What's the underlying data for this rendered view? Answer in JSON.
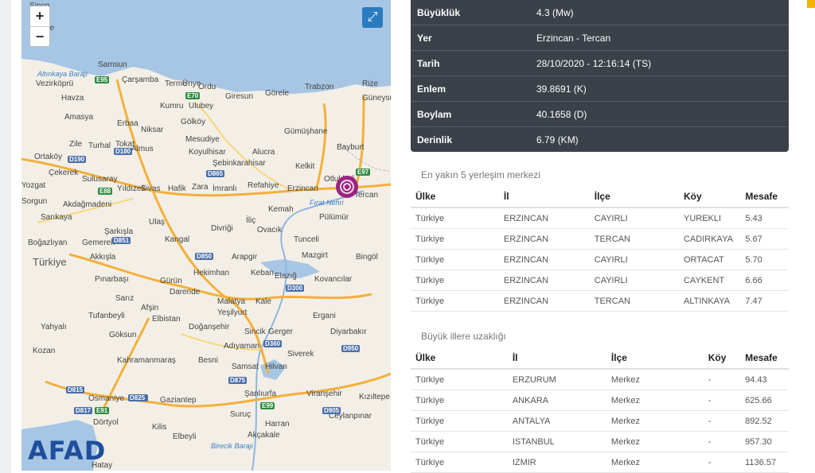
{
  "map": {
    "zoom_in": "+",
    "zoom_out": "−",
    "fullscreen": "⤢",
    "logo": "AFAD",
    "labels": [
      {
        "t": "Sinop"
      },
      {
        "t": "Gerze"
      },
      {
        "t": "Samsun"
      },
      {
        "t": "Altınkaya Barajı"
      },
      {
        "t": "Vezirköprü"
      },
      {
        "t": "Havza"
      },
      {
        "t": "Çarşamba"
      },
      {
        "t": "Terme"
      },
      {
        "t": "Ünye"
      },
      {
        "t": "Ordu"
      },
      {
        "t": "Giresun"
      },
      {
        "t": "Görele"
      },
      {
        "t": "Trabzon"
      },
      {
        "t": "Rize"
      },
      {
        "t": "Güneysu"
      },
      {
        "t": "Amasya"
      },
      {
        "t": "Tokat"
      },
      {
        "t": "Kumru"
      },
      {
        "t": "Ulubey"
      },
      {
        "t": "Gölköy"
      },
      {
        "t": "Mesudiye"
      },
      {
        "t": "Koyulhisar"
      },
      {
        "t": "Şebinkarahisar"
      },
      {
        "t": "Gümüşhane"
      },
      {
        "t": "Bayburt"
      },
      {
        "t": "Alucra"
      },
      {
        "t": "Kelkit"
      },
      {
        "t": "Erzincan"
      },
      {
        "t": "Tercan"
      },
      {
        "t": "Otlukbeli"
      },
      {
        "t": "Sivas"
      },
      {
        "t": "Hafik"
      },
      {
        "t": "Zara"
      },
      {
        "t": "İmranlı"
      },
      {
        "t": "Refahiye"
      },
      {
        "t": "Kemah"
      },
      {
        "t": "Pülümür"
      },
      {
        "t": "Tunceli"
      },
      {
        "t": "Mazgirt"
      },
      {
        "t": "Bingöl"
      },
      {
        "t": "Ovacık"
      },
      {
        "t": "İliç"
      },
      {
        "t": "Divriği"
      },
      {
        "t": "Arapgir"
      },
      {
        "t": "Kangal"
      },
      {
        "t": "Ulaş"
      },
      {
        "t": "Gürün"
      },
      {
        "t": "Hekimhan"
      },
      {
        "t": "Keban"
      },
      {
        "t": "Elazığ"
      },
      {
        "t": "Kovancılar"
      },
      {
        "t": "Malatya"
      },
      {
        "t": "Darende"
      },
      {
        "t": "Yeşilyurt"
      },
      {
        "t": "Kale"
      },
      {
        "t": "Doğanşehir"
      },
      {
        "t": "Sincik"
      },
      {
        "t": "Gerger"
      },
      {
        "t": "Ergani"
      },
      {
        "t": "Diyarbakır"
      },
      {
        "t": "Adıyaman"
      },
      {
        "t": "Kahramanmaraş"
      },
      {
        "t": "Besni"
      },
      {
        "t": "Samsat"
      },
      {
        "t": "Hilvan"
      },
      {
        "t": "Siverek"
      },
      {
        "t": "Gaziantep"
      },
      {
        "t": "Şanlıurfa"
      },
      {
        "t": "Viranşehir"
      },
      {
        "t": "Osmaniye"
      },
      {
        "t": "Kilis"
      },
      {
        "t": "Elbeyli"
      },
      {
        "t": "Suruç"
      },
      {
        "t": "Harran"
      },
      {
        "t": "Akçakale"
      },
      {
        "t": "Ceylanpınar"
      },
      {
        "t": "Kızıltepe"
      },
      {
        "t": "Dörtyol"
      },
      {
        "t": "Hatay"
      },
      {
        "t": "Türkiye"
      },
      {
        "t": "Elbistan"
      },
      {
        "t": "Göksun"
      },
      {
        "t": "Afşin"
      },
      {
        "t": "Pınarbaşı"
      },
      {
        "t": "Sarız"
      },
      {
        "t": "Tufanbeyli"
      },
      {
        "t": "Kozan"
      },
      {
        "t": "Yahyalı"
      },
      {
        "t": "Akkışla"
      },
      {
        "t": "Gemerek"
      },
      {
        "t": "Şarkışla"
      },
      {
        "t": "Yozgat"
      },
      {
        "t": "Sorgun"
      },
      {
        "t": "Çekerek"
      },
      {
        "t": "Turhal"
      },
      {
        "t": "Zile"
      },
      {
        "t": "Erbaa"
      },
      {
        "t": "Niksar"
      },
      {
        "t": "Almus"
      },
      {
        "t": "Ortaköy"
      },
      {
        "t": "Sulusaray"
      },
      {
        "t": "Yıldızeli"
      },
      {
        "t": "Akdağmadeni"
      },
      {
        "t": "Sarıkaya"
      },
      {
        "t": "Boğazlıyan"
      },
      {
        "t": "Fırat Nehri"
      },
      {
        "t": "Birecik Barajı"
      }
    ],
    "road_badges": [
      "E95",
      "E70",
      "D180",
      "D865",
      "E88",
      "D190",
      "E97",
      "D851",
      "D850",
      "D300",
      "D360",
      "D950",
      "D875",
      "D825",
      "E99",
      "D815",
      "E91",
      "D905",
      "D817",
      "D825"
    ]
  },
  "details": [
    {
      "key": "Büyüklük",
      "value": "4.3 (Mw)"
    },
    {
      "key": "Yer",
      "value": "Erzincan - Tercan"
    },
    {
      "key": "Tarih",
      "value": "28/10/2020 - 12:16:14 (TS)"
    },
    {
      "key": "Enlem",
      "value": "39.8691 (K)"
    },
    {
      "key": "Boylam",
      "value": "40.1658 (D)"
    },
    {
      "key": "Derinlik",
      "value": "6.79 (KM)"
    }
  ],
  "nearest": {
    "title": "En yakın 5 yerleşim merkezi",
    "headers": [
      "Ülke",
      "İl",
      "İlçe",
      "Köy",
      "Mesafe"
    ],
    "rows": [
      [
        "Türkiye",
        "ERZINCAN",
        "CAYIRLI",
        "YUREKLI",
        "5.43"
      ],
      [
        "Türkiye",
        "ERZINCAN",
        "TERCAN",
        "CADIRKAYA",
        "5.67"
      ],
      [
        "Türkiye",
        "ERZINCAN",
        "CAYIRLI",
        "ORTACAT",
        "5.70"
      ],
      [
        "Türkiye",
        "ERZINCAN",
        "CAYIRLI",
        "CAYKENT",
        "6.66"
      ],
      [
        "Türkiye",
        "ERZINCAN",
        "TERCAN",
        "ALTINKAYA",
        "7.47"
      ]
    ]
  },
  "cities": {
    "title": "Büyük illere uzaklığı",
    "headers": [
      "Ülke",
      "İl",
      "İlçe",
      "Köy",
      "Mesafe"
    ],
    "rows": [
      [
        "Türkiye",
        "ERZURUM",
        "Merkez",
        "-",
        "94.43"
      ],
      [
        "Türkiye",
        "ANKARA",
        "Merkez",
        "-",
        "625.66"
      ],
      [
        "Türkiye",
        "ANTALYA",
        "Merkez",
        "-",
        "892.52"
      ],
      [
        "Türkiye",
        "ISTANBUL",
        "Merkez",
        "-",
        "957.30"
      ],
      [
        "Türkiye",
        "IZMIR",
        "Merkez",
        "-",
        "1136.57"
      ]
    ]
  }
}
